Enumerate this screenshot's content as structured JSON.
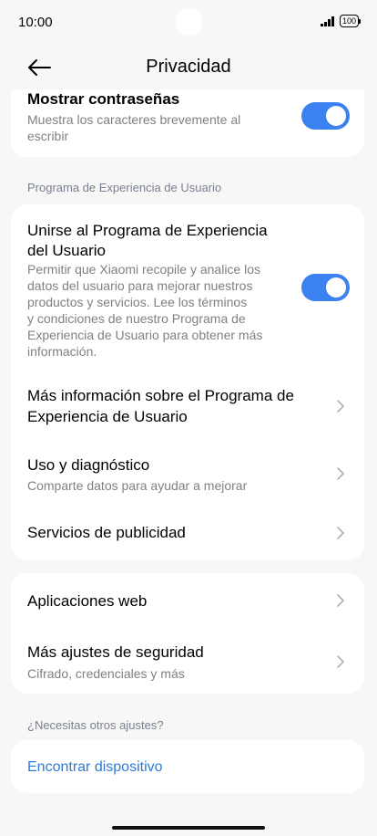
{
  "status": {
    "time": "10:00",
    "battery": "100"
  },
  "header": {
    "title": "Privacidad",
    "back_icon": "arrow-left-icon"
  },
  "password_card": {
    "title": "Mostrar contraseñas",
    "subtitle_line1": "Muestra los caracteres brevemente al",
    "subtitle_line2": "escribir",
    "toggle_on": true
  },
  "section1": {
    "label": "Programa de Experiencia de Usuario"
  },
  "program_card": {
    "join": {
      "title_line1": "Unirse al Programa de Experiencia",
      "title_line2": "del Usuario",
      "desc_lines": [
        "Permitir que Xiaomi recopile y analice los",
        "datos del usuario para mejorar nuestros",
        "productos y servicios. Lee los términos",
        "y condiciones de nuestro Programa de",
        "Experiencia de Usuario para obtener más",
        "información."
      ],
      "toggle_on": true
    },
    "more_info": {
      "title_line1": "Más información sobre el Programa de",
      "title_line2": "Experiencia de Usuario"
    },
    "diagnostics": {
      "title": "Uso y diagnóstico",
      "subtitle": "Comparte datos para ayudar a mejorar"
    },
    "ads": {
      "title": "Servicios de publicidad"
    }
  },
  "misc_card": {
    "web_apps": {
      "title": "Aplicaciones web"
    },
    "security": {
      "title": "Más ajustes de seguridad",
      "subtitle": "Cifrado, credenciales y más"
    }
  },
  "section2": {
    "label": "¿Necesitas otros ajustes?"
  },
  "find_card": {
    "link": "Encontrar dispositivo"
  },
  "colors": {
    "accent": "#3b82f0",
    "link": "#2f7ad6",
    "background": "#f7f7f7"
  }
}
